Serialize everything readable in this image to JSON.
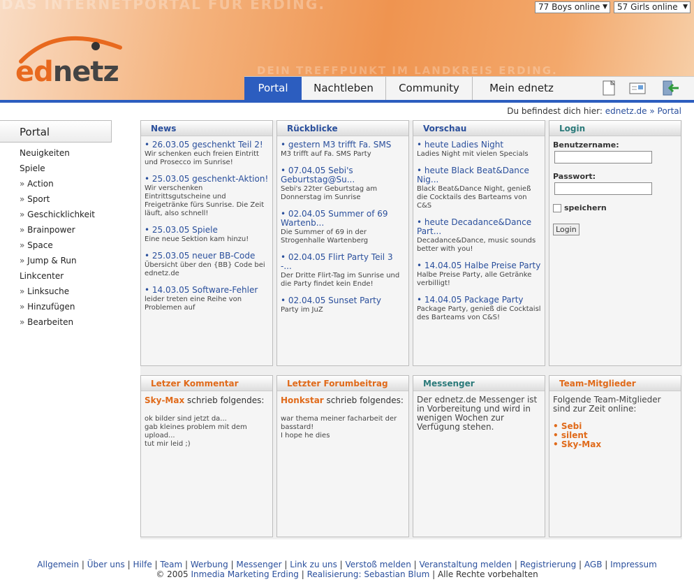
{
  "header": {
    "tagline_top": "DAS INTERNETPORTAL FÜR ERDING.",
    "tagline_bottom": "DEIN TREFFPUNKT IM LANDKREIS ERDING.",
    "logo_ed": "ed",
    "logo_netz": "netz",
    "boys_online": "77 Boys online",
    "girls_online": "57 Girls online"
  },
  "tabs": [
    {
      "label": "Portal",
      "active": true
    },
    {
      "label": "Nachtleben",
      "active": false
    },
    {
      "label": "Community",
      "active": false
    },
    {
      "label": "Mein ednetz",
      "active": false
    }
  ],
  "toolbar_icons": [
    "page-icon",
    "card-icon",
    "logout-icon"
  ],
  "breadcrumb": {
    "prefix": "Du befindest dich hier: ",
    "root": "ednetz.de",
    "sep": " » ",
    "current": "Portal"
  },
  "sidebar": {
    "title": "Portal",
    "items": [
      {
        "label": "Neuigkeiten",
        "sub": false
      },
      {
        "label": "Spiele",
        "sub": false
      },
      {
        "label": "Action",
        "sub": true
      },
      {
        "label": "Sport",
        "sub": true
      },
      {
        "label": "Geschicklichkeit",
        "sub": true
      },
      {
        "label": "Brainpower",
        "sub": true
      },
      {
        "label": "Space",
        "sub": true
      },
      {
        "label": "Jump & Run",
        "sub": true
      },
      {
        "label": "Linkcenter",
        "sub": false
      },
      {
        "label": "Linksuche",
        "sub": true
      },
      {
        "label": "Hinzufügen",
        "sub": true
      },
      {
        "label": "Bearbeiten",
        "sub": true
      }
    ]
  },
  "news": {
    "title": "News",
    "items": [
      {
        "t": "26.03.05 geschenkt Teil 2!",
        "d": "Wir schenken euch freien Eintritt und Prosecco im Sunrise!"
      },
      {
        "t": "25.03.05 geschenkt-Aktion!",
        "d": "Wir verschenken Eintrittsgutscheine und Freigetränke fürs Sunrise. Die Zeit läuft, also schnell!"
      },
      {
        "t": "25.03.05 Spiele",
        "d": "Eine neue Sektion kam hinzu!"
      },
      {
        "t": "25.03.05 neuer BB-Code",
        "d": "Übersicht über den {BB} Code bei ednetz.de"
      },
      {
        "t": "14.03.05 Software-Fehler",
        "d": "leider treten eine Reihe von Problemen auf"
      }
    ]
  },
  "rueckblicke": {
    "title": "Rückblicke",
    "items": [
      {
        "t": "gestern M3 trifft Fa. SMS",
        "d": "M3 trifft auf Fa. SMS Party"
      },
      {
        "t": "07.04.05 Sebi's Geburtstag@Su...",
        "d": "Sebi's 22ter Geburtstag am Donnerstag im Sunrise"
      },
      {
        "t": "02.04.05 Summer of 69 Wartenb...",
        "d": "Die Summer of 69 in der Strogenhalle Wartenberg"
      },
      {
        "t": "02.04.05 Flirt Party Teil 3 -...",
        "d": "Der Dritte Flirt-Tag im Sunrise und die Party findet kein Ende!"
      },
      {
        "t": "02.04.05 Sunset Party",
        "d": "Party im JuZ"
      }
    ]
  },
  "vorschau": {
    "title": "Vorschau",
    "items": [
      {
        "t": "heute Ladies Night",
        "d": "Ladies Night mit vielen Specials"
      },
      {
        "t": "heute Black Beat&Dance Nig...",
        "d": "Black Beat&Dance Night, genieß die Cocktails des Barteams von C&S"
      },
      {
        "t": "heute Decadance&Dance Part...",
        "d": "Decadance&Dance, music sounds better with you!"
      },
      {
        "t": "14.04.05 Halbe Preise Party",
        "d": "Halbe Preise Party, alle Getränke verbilligt!"
      },
      {
        "t": "14.04.05 Package Party",
        "d": "Package Party, genieß die Cocktaisl des Barteams von C&S!"
      }
    ]
  },
  "login": {
    "title": "Login",
    "user_label": "Benutzername:",
    "user_value": "",
    "pass_label": "Passwort:",
    "pass_value": "",
    "remember_label": "speichern",
    "button": "Login"
  },
  "kommentar": {
    "title": "Letzer Kommentar",
    "author": "Sky-Max",
    "wrote": " schrieb folgendes:",
    "text": "ok bilder sind jetzt da...\ngab kleines problem mit dem upload...\ntut mir leid ;)"
  },
  "forum": {
    "title": "Letzter Forumbeitrag",
    "author": "Honkstar",
    "wrote": " schrieb folgendes:",
    "text": "war thema meiner facharbeit der basstard!\nI hope he dies"
  },
  "messenger": {
    "title": "Messenger",
    "text": "Der ednetz.de Messenger ist in Vorbereitung und wird in wenigen Wochen zur Verfügung stehen."
  },
  "team": {
    "title": "Team-Mitglieder",
    "intro": "Folgende Team-Mitglieder sind zur Zeit online:",
    "members": [
      "Sebi",
      "silent",
      "Sky-Max"
    ]
  },
  "footer": {
    "links": [
      "Allgemein",
      "Über uns",
      "Hilfe",
      "Team",
      "Werbung",
      "Messenger",
      "Link zu uns",
      "Verstoß melden",
      "Veranstaltung melden",
      "Registrierung",
      "AGB",
      "Impressum"
    ],
    "copy_prefix": "© 2005 ",
    "company": "Inmedia Marketing Erding",
    "sep": " | ",
    "realisierung": "Realisierung: Sebastian Blum",
    "rights": " | Alle Rechte vorbehalten"
  }
}
